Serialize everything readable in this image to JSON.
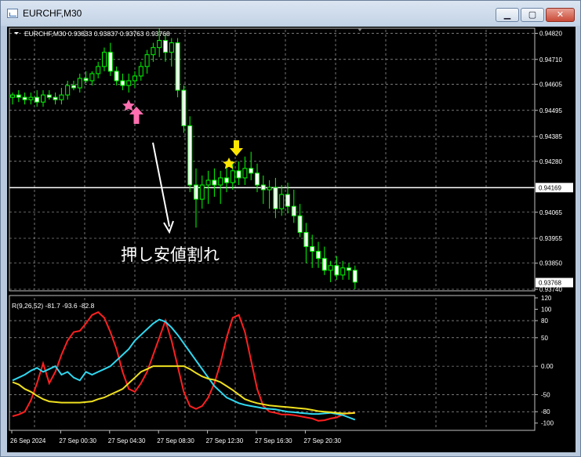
{
  "window": {
    "title": "EURCHF,M30",
    "min_glyph": "▁",
    "max_glyph": "▢",
    "close_glyph": "✕"
  },
  "colors": {
    "bull": "#00ff00",
    "bear": "#00ff00",
    "red_line": "#ff2020",
    "cyan_line": "#30d8f0",
    "yellow_line": "#f0e020",
    "grid": "#c0c0c0",
    "text": "#ffffff",
    "pink": "#ff6fb0",
    "yellow_mark": "#ffe600"
  },
  "chart_data": [
    {
      "type": "candlestick",
      "header": "EURCHF,M30  0.93833 0.93837 0.93763 0.93768",
      "symbol": "EURCHF,M30",
      "last_ohlc": [
        0.93833,
        0.93837,
        0.93763,
        0.93768
      ],
      "ylim": [
        0.9374,
        0.94835
      ],
      "y_ticks": [
        0.9482,
        0.9471,
        0.94605,
        0.94495,
        0.94385,
        0.9428,
        0.94065,
        0.93955,
        0.9385,
        0.9374
      ],
      "y_tick_labels": [
        "0.94820",
        "0.94710",
        "0.94605",
        "0.94495",
        "0.94385",
        "0.94280",
        "0.94065",
        "0.93955",
        "0.93850",
        "0.93740"
      ],
      "horizontal_line": {
        "value": 0.94169,
        "label": "0.94169"
      },
      "price_marker": {
        "value": 0.93768,
        "label": "0.93768"
      },
      "annotation_text": "押し安値割れ",
      "candles": [
        [
          0.9455,
          0.9457,
          0.9452,
          0.9456
        ],
        [
          0.9456,
          0.9458,
          0.9453,
          0.9455
        ],
        [
          0.9455,
          0.9457,
          0.9452,
          0.9454
        ],
        [
          0.9454,
          0.9457,
          0.9452,
          0.9455
        ],
        [
          0.9455,
          0.9458,
          0.9451,
          0.9453
        ],
        [
          0.9453,
          0.9458,
          0.9451,
          0.9456
        ],
        [
          0.9456,
          0.9458,
          0.9454,
          0.9455
        ],
        [
          0.9455,
          0.9457,
          0.9452,
          0.9454
        ],
        [
          0.9454,
          0.9459,
          0.9452,
          0.9456
        ],
        [
          0.9456,
          0.9462,
          0.9454,
          0.946
        ],
        [
          0.946,
          0.9462,
          0.9458,
          0.9459
        ],
        [
          0.9459,
          0.9465,
          0.9457,
          0.9463
        ],
        [
          0.9463,
          0.9466,
          0.9461,
          0.9462
        ],
        [
          0.9462,
          0.9466,
          0.946,
          0.9465
        ],
        [
          0.9465,
          0.947,
          0.9463,
          0.9468
        ],
        [
          0.9468,
          0.9476,
          0.9466,
          0.9474
        ],
        [
          0.9474,
          0.9478,
          0.9464,
          0.9466
        ],
        [
          0.9466,
          0.9468,
          0.946,
          0.9462
        ],
        [
          0.9462,
          0.9465,
          0.9458,
          0.946
        ],
        [
          0.946,
          0.9465,
          0.9457,
          0.9462
        ],
        [
          0.9462,
          0.9466,
          0.9459,
          0.9464
        ],
        [
          0.9464,
          0.947,
          0.9462,
          0.9468
        ],
        [
          0.9468,
          0.9475,
          0.9465,
          0.9473
        ],
        [
          0.9473,
          0.9478,
          0.947,
          0.9476
        ],
        [
          0.9476,
          0.9484,
          0.9472,
          0.9479
        ],
        [
          0.9479,
          0.9482,
          0.947,
          0.9474
        ],
        [
          0.9474,
          0.948,
          0.9468,
          0.9478
        ],
        [
          0.9478,
          0.948,
          0.9455,
          0.9458
        ],
        [
          0.9458,
          0.946,
          0.944,
          0.9443
        ],
        [
          0.9443,
          0.9447,
          0.9415,
          0.9418
        ],
        [
          0.9418,
          0.9425,
          0.94,
          0.9412
        ],
        [
          0.9412,
          0.9422,
          0.9408,
          0.9418
        ],
        [
          0.9418,
          0.9424,
          0.941,
          0.942
        ],
        [
          0.942,
          0.9425,
          0.9413,
          0.9418
        ],
        [
          0.9418,
          0.9424,
          0.941,
          0.9421
        ],
        [
          0.9421,
          0.9426,
          0.9415,
          0.9419
        ],
        [
          0.9419,
          0.9428,
          0.9416,
          0.9424
        ],
        [
          0.9424,
          0.9428,
          0.9418,
          0.9421
        ],
        [
          0.9421,
          0.943,
          0.9418,
          0.9425
        ],
        [
          0.9425,
          0.9432,
          0.942,
          0.9423
        ],
        [
          0.9423,
          0.9427,
          0.9415,
          0.9418
        ],
        [
          0.9418,
          0.9422,
          0.941,
          0.9416
        ],
        [
          0.9416,
          0.942,
          0.9408,
          0.9417
        ],
        [
          0.9417,
          0.9421,
          0.9404,
          0.9408
        ],
        [
          0.9408,
          0.9418,
          0.9405,
          0.9414
        ],
        [
          0.9414,
          0.9419,
          0.9406,
          0.9409
        ],
        [
          0.9409,
          0.9416,
          0.9402,
          0.9405
        ],
        [
          0.9405,
          0.941,
          0.9396,
          0.9398
        ],
        [
          0.9398,
          0.9402,
          0.9385,
          0.9392
        ],
        [
          0.9392,
          0.9397,
          0.9383,
          0.939
        ],
        [
          0.939,
          0.9394,
          0.9383,
          0.9387
        ],
        [
          0.9387,
          0.9392,
          0.938,
          0.9382
        ],
        [
          0.9382,
          0.9386,
          0.9377,
          0.9384
        ],
        [
          0.9384,
          0.9388,
          0.9378,
          0.938
        ],
        [
          0.938,
          0.9386,
          0.9378,
          0.9383
        ],
        [
          0.9383,
          0.9385,
          0.9378,
          0.9382
        ],
        [
          0.9382,
          0.9384,
          0.9374,
          0.9377
        ]
      ]
    },
    {
      "type": "line",
      "header": "R(9,26,52) -81.7 -93.6 -82.8",
      "params": "R(9,26,52)",
      "last_values": [
        -81.7,
        -93.6,
        -82.8
      ],
      "ylim": [
        -110,
        120
      ],
      "y_ticks": [
        120,
        100,
        80,
        50,
        0,
        -50,
        -80,
        -100
      ],
      "y_tick_labels": [
        "120",
        "100",
        "80",
        "50",
        "0.00",
        "-50",
        "-80",
        "-100"
      ],
      "x_labels": [
        "26 Sep 2024",
        "27 Sep 00:30",
        "27 Sep 04:30",
        "27 Sep 08:30",
        "27 Sep 12:30",
        "27 Sep 16:30",
        "27 Sep 20:30"
      ],
      "x_label_positions": [
        0,
        8,
        16,
        24,
        32,
        40,
        48
      ],
      "series": [
        {
          "color": "#ff2020",
          "values": [
            -88,
            -85,
            -80,
            -60,
            -30,
            5,
            -30,
            -10,
            20,
            45,
            60,
            62,
            75,
            90,
            95,
            85,
            60,
            30,
            -10,
            -40,
            -45,
            -30,
            -10,
            20,
            50,
            80,
            45,
            0,
            -45,
            -70,
            -75,
            -70,
            -55,
            -30,
            5,
            50,
            85,
            90,
            60,
            10,
            -40,
            -70,
            -80,
            -82,
            -85,
            -85,
            -86,
            -88,
            -90,
            -92,
            -96,
            -95,
            -92,
            -90,
            -85,
            -82,
            -82
          ]
        },
        {
          "color": "#30d8f0",
          "values": [
            -25,
            -20,
            -15,
            -8,
            -3,
            -10,
            -5,
            0,
            -15,
            -10,
            -20,
            -25,
            -10,
            -15,
            -10,
            -5,
            0,
            10,
            20,
            30,
            45,
            55,
            65,
            75,
            82,
            78,
            68,
            55,
            40,
            25,
            10,
            -5,
            -20,
            -35,
            -45,
            -55,
            -60,
            -65,
            -68,
            -70,
            -72,
            -74,
            -75,
            -76,
            -78,
            -80,
            -81,
            -82,
            -83,
            -84,
            -84,
            -83,
            -82,
            -84,
            -86,
            -90,
            -94
          ]
        },
        {
          "color": "#f0e020",
          "values": [
            -28,
            -32,
            -40,
            -45,
            -52,
            -58,
            -62,
            -63,
            -64,
            -64,
            -64,
            -64,
            -63,
            -62,
            -58,
            -55,
            -50,
            -45,
            -40,
            -30,
            -20,
            -10,
            -5,
            0,
            0,
            0,
            0,
            0,
            0,
            -5,
            -12,
            -18,
            -22,
            -24,
            -28,
            -35,
            -42,
            -50,
            -58,
            -62,
            -65,
            -67,
            -69,
            -70,
            -71,
            -72,
            -73,
            -74,
            -75,
            -77,
            -79,
            -80,
            -81,
            -82,
            -83,
            -83,
            -82
          ]
        }
      ]
    }
  ]
}
